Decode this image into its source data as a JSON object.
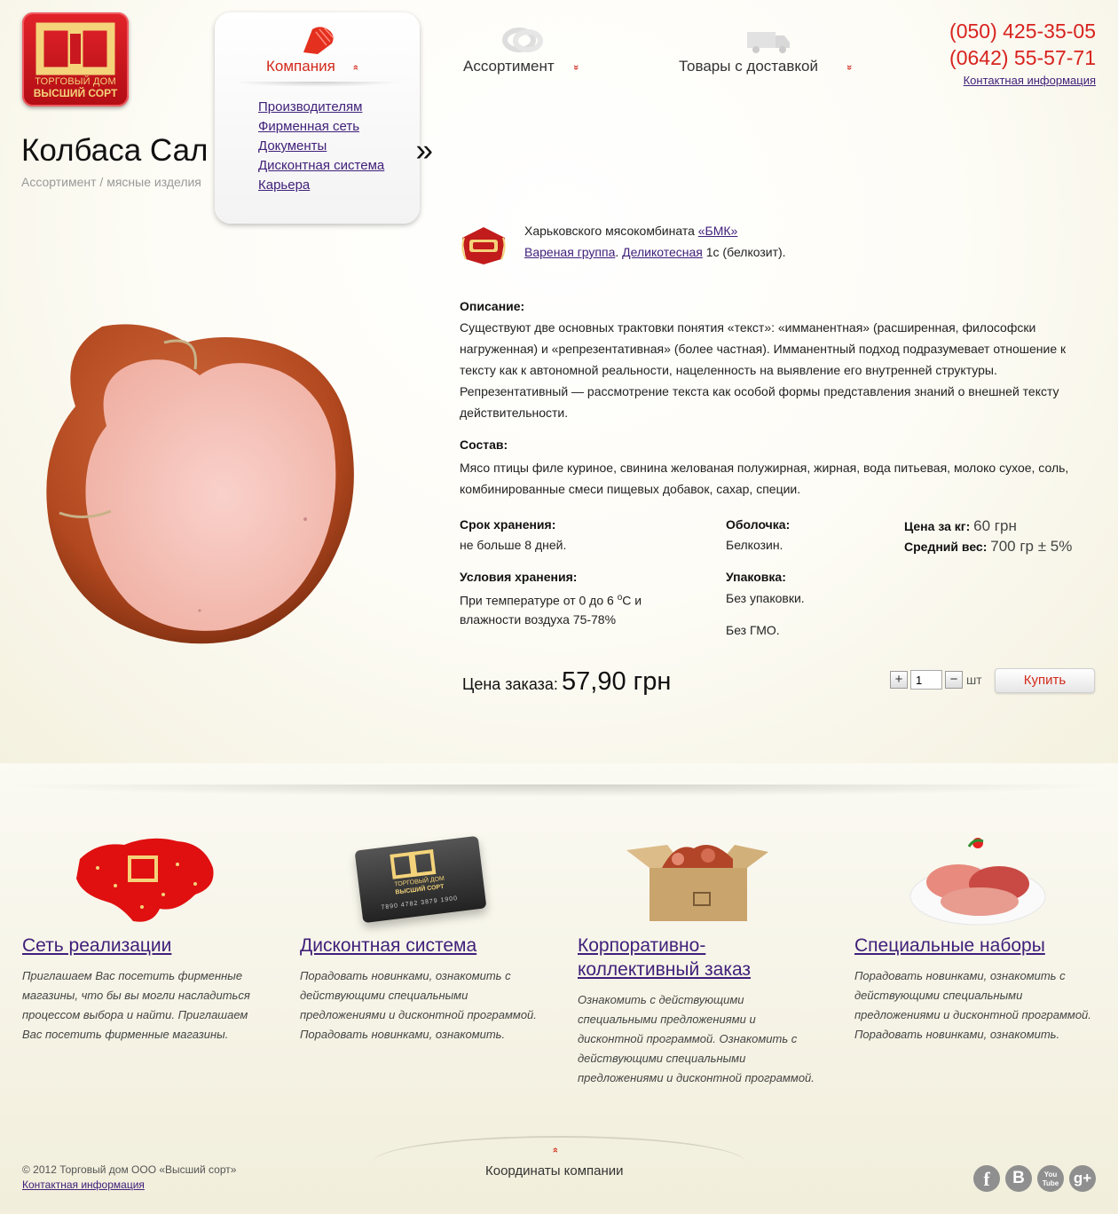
{
  "logo": {
    "line1": "ТОРГОВЫЙ ДОМ",
    "line2": "ВЫСШИЙ СОРТ",
    "colors": {
      "bg": "#c91820",
      "gold": "#f4d37a"
    }
  },
  "nav": {
    "items": [
      {
        "label": "Компания",
        "icon": "sausage-slice-icon",
        "chevron": "»"
      },
      {
        "label": "Ассортимент",
        "icon": "sausage-ring-icon",
        "chevron": "»"
      },
      {
        "label": "Товары с доставкой",
        "icon": "delivery-van-icon",
        "chevron": "»"
      }
    ],
    "submenu": [
      "Производителям",
      "Фирменная сеть",
      "Документы",
      "Дисконтная система",
      "Карьера"
    ]
  },
  "contacts": {
    "phone1": "(050) 425-35-05",
    "phone2": "(0642) 55-57-71",
    "link": "Контактная информация"
  },
  "page": {
    "title_left": "Колбаса Сал",
    "title_right": "»",
    "breadcrumb_link": "Ассортимент",
    "breadcrumb_sep": " / ",
    "breadcrumb_current": "мясные изделия"
  },
  "product": {
    "maker_prefix": "Харьковского мясокомбината ",
    "maker_link": "«БМК»",
    "group_link": "Вареная группа",
    "sep": ". ",
    "type_link": "Деликотесная",
    "grade_suffix": " 1с (белкозит).",
    "description_title": "Описание:",
    "description": "Существуют две основных трактовки понятия «текст»: «имманентная» (расширенная, философски нагруженная) и «репрезентативная» (более частная). Имманентный подход подразумевает отношение к тексту как к автономной реальности, нацеленность на выявление его внутренней структуры. Репрезентативный — рассмотрение текста как особой формы представления знаний о внешней тексту действительности.",
    "composition_title": "Состав:",
    "composition": "Мясо птицы филе куриное, свинина желованая полужирная, жирная, вода питьевая, молоко сухое, соль, комбинированные смеси пищевых добавок, сахар, специи.",
    "shelf_label": "Срок хранения:",
    "shelf_value": "не больше 8 дней.",
    "storage_label": "Условия хранения:",
    "storage_value_1": "При температуре от 0 до 6 ",
    "storage_deg": "o",
    "storage_value_2": "С и",
    "storage_value_3": "влажности воздуха 75-78%",
    "casing_label": "Оболочка:",
    "casing_value": "Белкозин.",
    "pack_label": "Упаковка:",
    "pack_value": "Без упаковки.",
    "gmo": "Без ГМО.",
    "price_kg_label": "Цена за кг:",
    "price_kg_value": "60 грн",
    "avg_weight_label": "Средний вес:",
    "avg_weight_value": "700 гр ± 5%",
    "order_label": "Цена заказа:",
    "order_price": "57,90 грн",
    "qty": "1",
    "qty_unit": "шт",
    "plus": "+",
    "minus": "−",
    "buy": "Купить"
  },
  "promos": [
    {
      "title": "Сеть реализации",
      "text": "Приглашаем Вас посетить фирменные магазины, что бы вы могли насладиться процессом выбора и найти. Приглашаем Вас посетить фирменные магазины."
    },
    {
      "title": "Дисконтная система",
      "text": "Порадовать новинками, ознакомить с действующими специальными предложениями и дисконтной программой. Порадовать новинками, ознакомить.",
      "card_line1": "ТОРГОВЫЙ ДОМ",
      "card_line2": "ВЫСШИЙ СОРТ",
      "card_number": "7890 4782 3879 1900"
    },
    {
      "title": "Корпоративно-коллективный заказ",
      "text": "Ознакомить с действующими специальными предложениями и дисконтной программой. Ознакомить с действующими специальными предложениями и дисконтной программой."
    },
    {
      "title": "Специальные наборы",
      "text": "Порадовать новинками, ознакомить с действующими специальными предложениями и дисконтной программой. Порадовать новинками, ознакомить."
    }
  ],
  "footer": {
    "coords": "Координаты компании",
    "chevron": "»",
    "copyright": "© 2012 Торговый дом ООО «Высший сорт»",
    "contact": "Контактная информация",
    "social": [
      {
        "icon": "facebook-icon",
        "glyph": "f"
      },
      {
        "icon": "vkontakte-icon",
        "glyph": "B"
      },
      {
        "icon": "youtube-icon",
        "glyph": "You Tube"
      },
      {
        "icon": "google-plus-icon",
        "glyph": "g+"
      }
    ]
  }
}
